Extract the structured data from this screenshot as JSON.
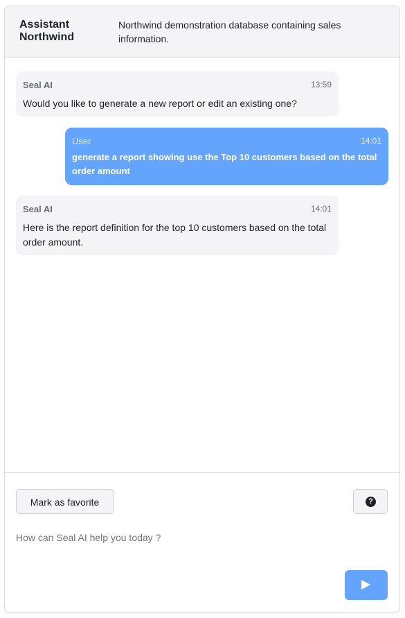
{
  "header": {
    "title": "Assistant Northwind",
    "description": "Northwind demonstration database containing sales information."
  },
  "messages": [
    {
      "sender": "Seal AI",
      "time": "13:59",
      "text": "Would you like to generate a new report or edit an existing one?"
    },
    {
      "sender": "User",
      "time": "14:01",
      "text": "generate a report showing use the Top 10 customers based on the total order amount"
    },
    {
      "sender": "Seal AI",
      "time": "14:01",
      "text": "Here is the report definition for the top 10 customers based on the total order amount."
    }
  ],
  "footer": {
    "favorite_label": "Mark as favorite",
    "help_icon": "question-circle-icon",
    "prompt_placeholder": "How can Seal AI help you today ?",
    "send_icon": "send-arrow-icon"
  },
  "colors": {
    "accent": "#63a4ff",
    "header_bg": "#f4f4f6",
    "ai_bubble_bg": "#f4f4f6"
  }
}
